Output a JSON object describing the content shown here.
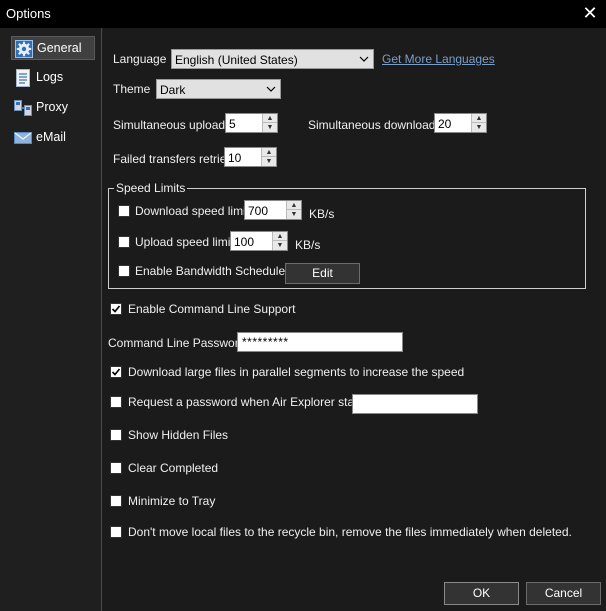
{
  "window": {
    "title": "Options",
    "close_glyph": "✕"
  },
  "sidebar": {
    "items": [
      {
        "label": "General",
        "icon": "gear-icon",
        "active": true
      },
      {
        "label": "Logs",
        "icon": "log-icon",
        "active": false
      },
      {
        "label": "Proxy",
        "icon": "proxy-icon",
        "active": false
      },
      {
        "label": "eMail",
        "icon": "mail-icon",
        "active": false
      }
    ]
  },
  "general": {
    "language_label": "Language",
    "language_value": "English (United States)",
    "more_languages_link": "Get More Languages",
    "theme_label": "Theme",
    "theme_value": "Dark",
    "sim_uploads_label": "Simultaneous uploads",
    "sim_uploads_value": "5",
    "sim_downloads_label": "Simultaneous downloads",
    "sim_downloads_value": "20",
    "retries_label": "Failed transfers retries",
    "retries_value": "10"
  },
  "speed_limits": {
    "title": "Speed Limits",
    "download_label": "Download speed limit",
    "download_value": "700",
    "download_unit": "KB/s",
    "download_checked": false,
    "upload_label": "Upload speed limit",
    "upload_value": "100",
    "upload_unit": "KB/s",
    "upload_checked": false,
    "scheduler_label": "Enable Bandwidth Scheduler",
    "scheduler_checked": false,
    "edit_label": "Edit"
  },
  "options": {
    "cmdline_support_label": "Enable Command Line Support",
    "cmdline_support_checked": true,
    "cmdline_password_label": "Command Line Password",
    "cmdline_password_value": "*********",
    "parallel_label": "Download large files in parallel segments to increase the speed",
    "parallel_checked": true,
    "request_password_label": "Request a password when Air Explorer starts",
    "request_password_checked": false,
    "request_password_value": "",
    "hidden_files_label": "Show Hidden Files",
    "hidden_files_checked": false,
    "clear_completed_label": "Clear Completed",
    "clear_completed_checked": false,
    "minimize_tray_label": "Minimize to Tray",
    "minimize_tray_checked": false,
    "recycle_label": "Don't move local files to the recycle bin, remove the files immediately when deleted.",
    "recycle_checked": false
  },
  "footer": {
    "ok_label": "OK",
    "cancel_label": "Cancel"
  }
}
